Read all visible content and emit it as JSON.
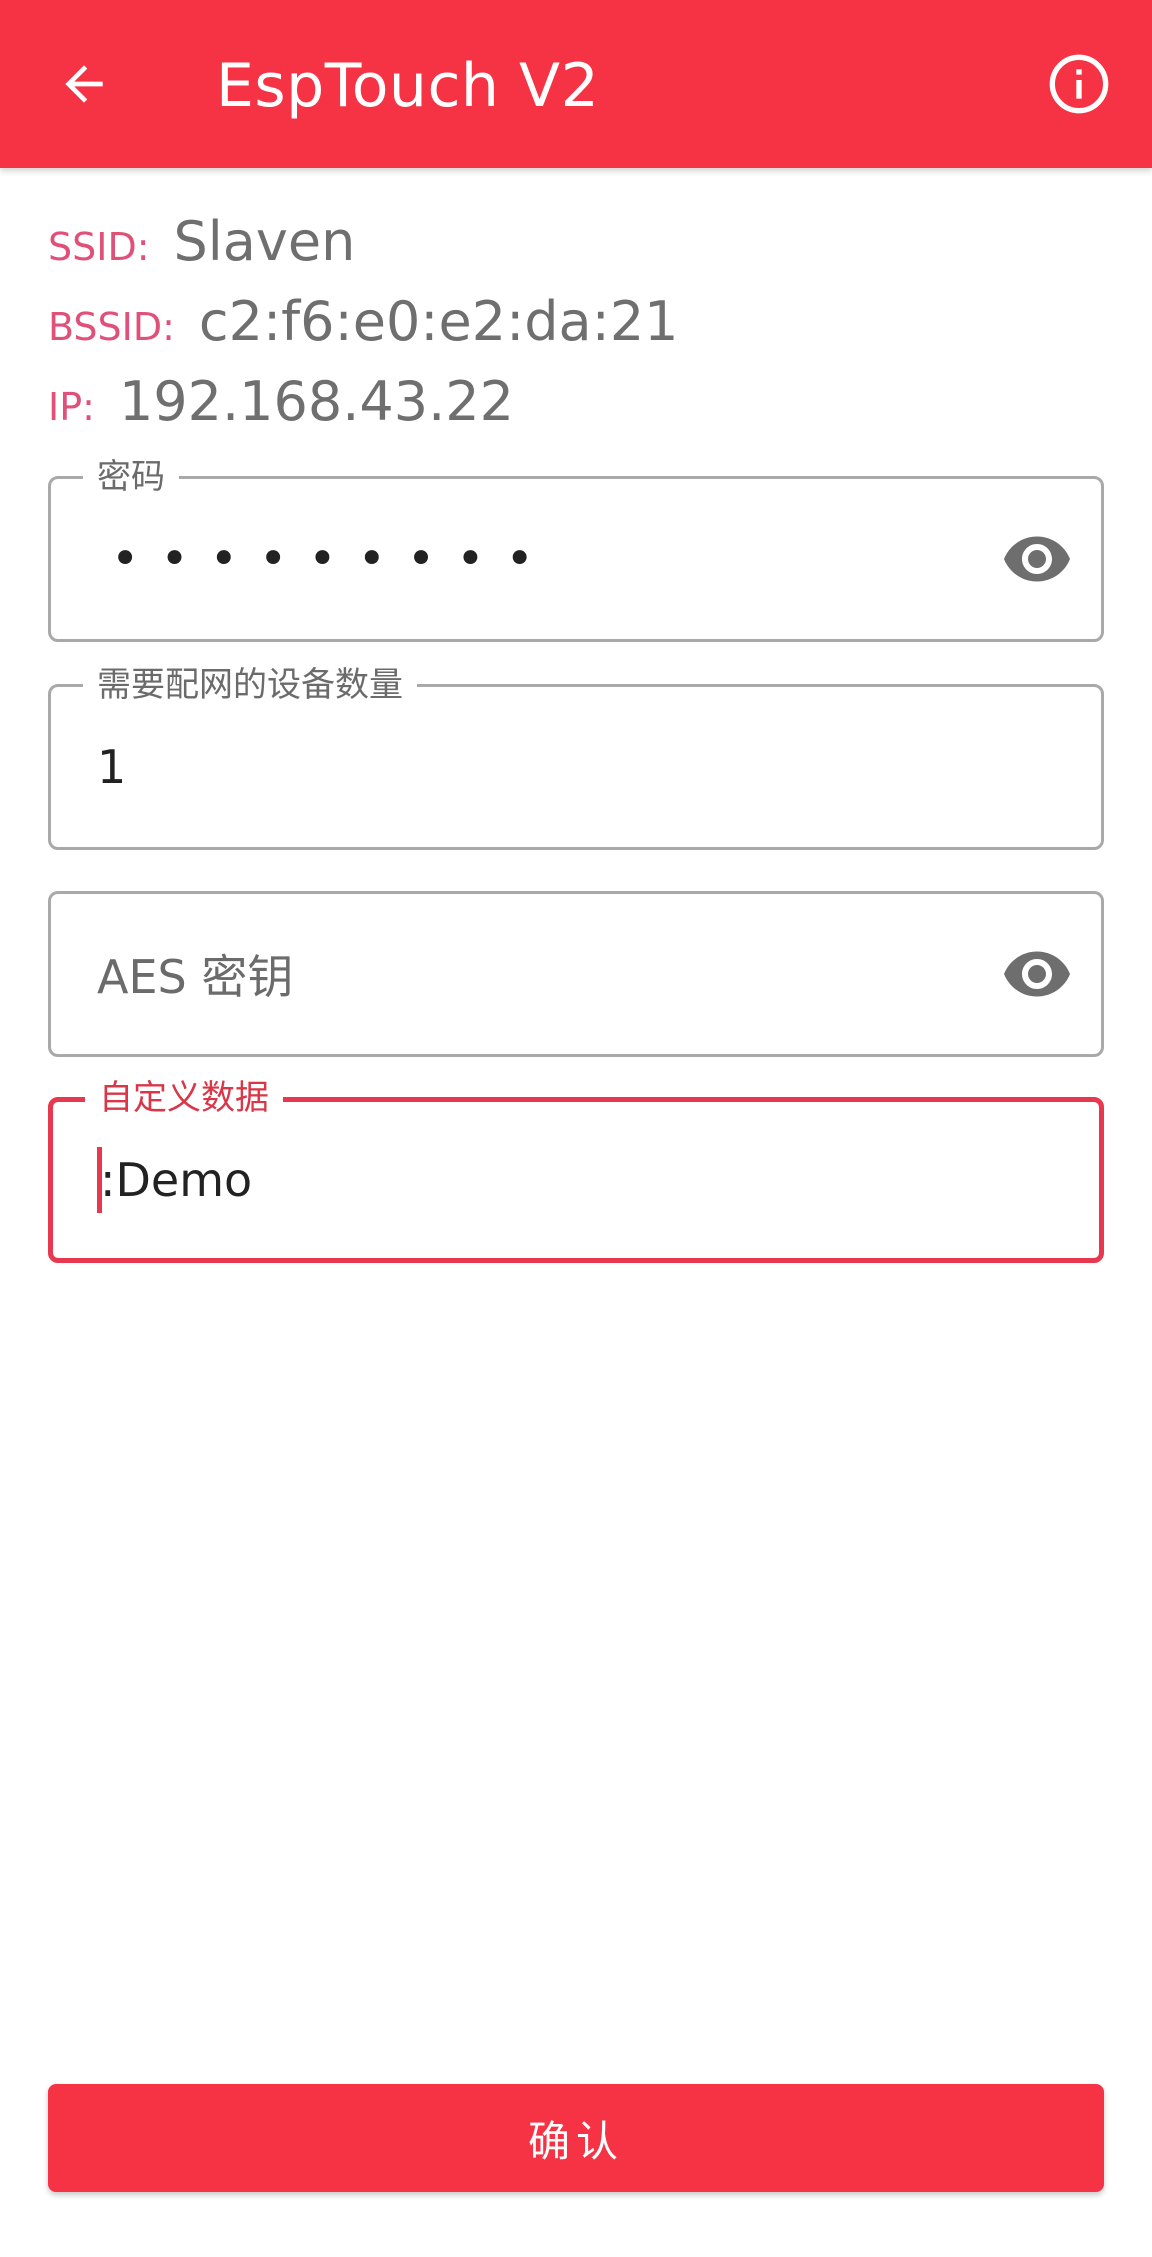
{
  "appbar": {
    "title": "EspTouch V2",
    "back_icon": "arrow-left-icon",
    "info_icon": "info-circle-icon",
    "color": "#f63245"
  },
  "wifi_info": {
    "ssid_label": "SSID:",
    "ssid_value": "Slaven",
    "bssid_label": "BSSID:",
    "bssid_value": "c2:f6:e0:e2:da:21",
    "ip_label": "IP:",
    "ip_value": "192.168.43.22"
  },
  "fields": {
    "password": {
      "label": "密码",
      "value": "•••••••••",
      "icon": "eye-icon"
    },
    "device_count": {
      "label": "需要配网的设备数量",
      "value": "1"
    },
    "aes_key": {
      "placeholder": "AES 密钥",
      "icon": "eye-icon"
    },
    "custom_data": {
      "label": "自定义数据",
      "value": ":Demo",
      "focused_color": "#e8384f"
    }
  },
  "confirm_button": {
    "label": "确认"
  }
}
